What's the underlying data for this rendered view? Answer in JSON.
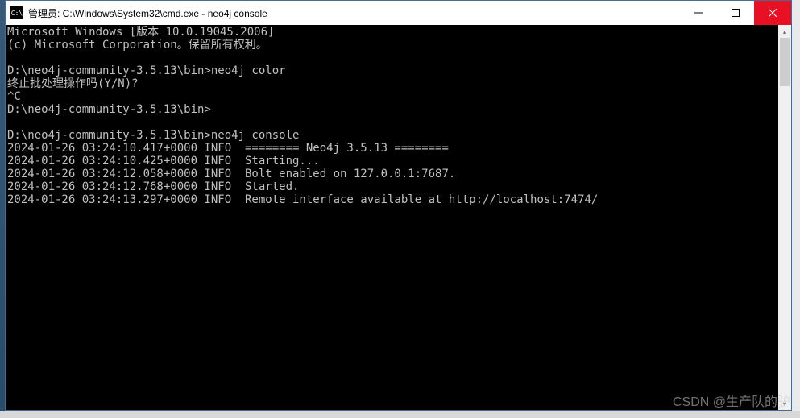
{
  "titlebar": {
    "icon_label": "C:\\",
    "title": "管理员: C:\\Windows\\System32\\cmd.exe - neo4j  console"
  },
  "terminal": {
    "lines": [
      "Microsoft Windows [版本 10.0.19045.2006]",
      "(c) Microsoft Corporation。保留所有权利。",
      "",
      "D:\\neo4j-community-3.5.13\\bin>neo4j color",
      "终止批处理操作吗(Y/N)?",
      "^C",
      "D:\\neo4j-community-3.5.13\\bin>",
      "",
      "D:\\neo4j-community-3.5.13\\bin>neo4j console",
      "2024-01-26 03:24:10.417+0000 INFO  ======== Neo4j 3.5.13 ========",
      "2024-01-26 03:24:10.425+0000 INFO  Starting...",
      "2024-01-26 03:24:12.058+0000 INFO  Bolt enabled on 127.0.0.1:7687.",
      "2024-01-26 03:24:12.768+0000 INFO  Started.",
      "2024-01-26 03:24:13.297+0000 INFO  Remote interface available at http://localhost:7474/"
    ]
  },
  "watermark": "CSDN @生产队的驴"
}
